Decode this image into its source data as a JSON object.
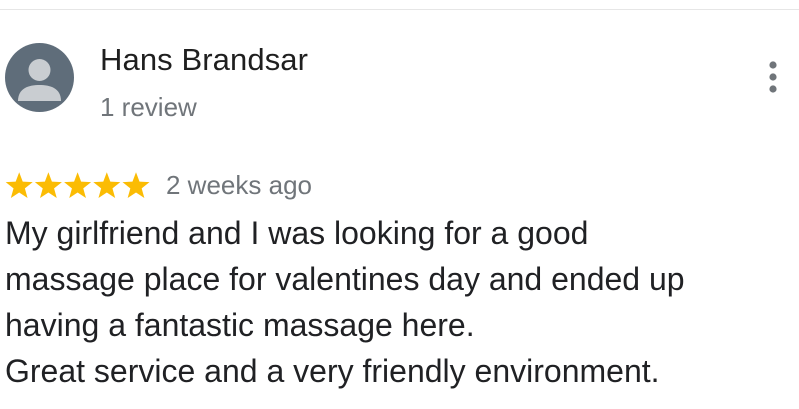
{
  "review": {
    "author_name": "Hans Brandsar",
    "review_count": "1 review",
    "rating": 5,
    "rating_max": 5,
    "date": "2 weeks ago",
    "text_lines": [
      "My girlfriend and I was looking for a good",
      "massage place for valentines day and ended up",
      "having a fantastic massage here.",
      "Great service and a very friendly environment."
    ]
  },
  "icons": {
    "avatar": "person-icon",
    "more": "more-vert-icon",
    "star": "star-icon"
  },
  "colors": {
    "star": "#fbbc04",
    "avatar_bg": "#5f6d7a",
    "avatar_fg": "#c9cdd1",
    "secondary_text": "#70757a",
    "primary_text": "#202124",
    "divider": "#e6e6e6"
  }
}
